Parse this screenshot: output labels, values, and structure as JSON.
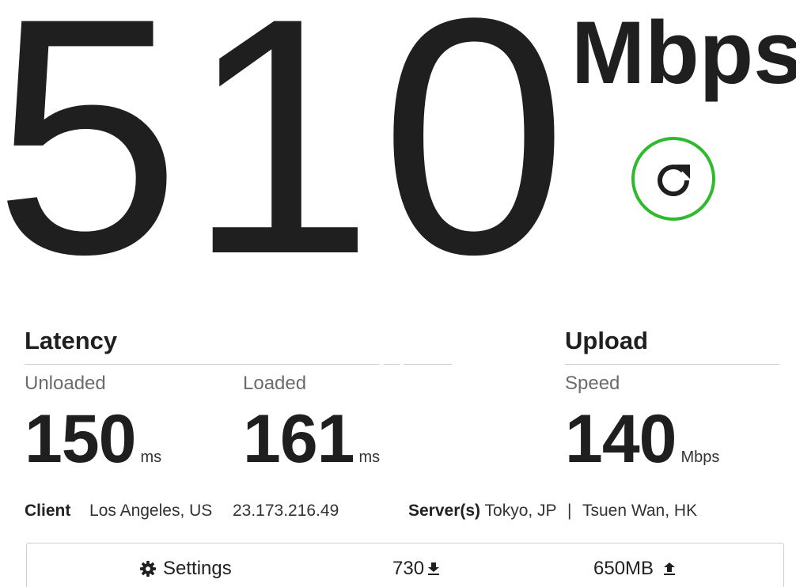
{
  "download": {
    "value": "510",
    "unit": "Mbps"
  },
  "retest_icon": "refresh-icon",
  "latency": {
    "title": "Latency",
    "unloaded": {
      "label": "Unloaded",
      "value": "150",
      "unit": "ms"
    },
    "loaded": {
      "label": "Loaded",
      "value": "161",
      "unit": "ms"
    }
  },
  "upload": {
    "title": "Upload",
    "speed": {
      "label": "Speed",
      "value": "140",
      "unit": "Mbps"
    }
  },
  "info": {
    "client_label": "Client",
    "client_location": "Los Angeles, US",
    "client_ip": "23.173.216.49",
    "server_label": "Server(s)",
    "server_1": "Tokyo, JP",
    "separator": "|",
    "server_2": "Tsuen Wan, HK"
  },
  "bottom_bar": {
    "settings_label": "Settings",
    "download_count": "730",
    "upload_size": "650MB"
  },
  "colors": {
    "accent": "#2dbb2d",
    "text": "#1f1f1f",
    "muted": "#6b6b6b"
  }
}
